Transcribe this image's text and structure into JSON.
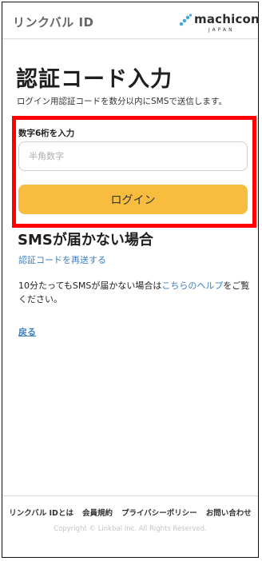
{
  "header": {
    "service_name": "リンクバル ID",
    "logo": {
      "text": "machicon",
      "sub": "JAPAN",
      "icon": "machicon-logo-icon"
    }
  },
  "main": {
    "title": "認証コード入力",
    "description": "ログイン用認証コードを数分以内にSMSで送信します。",
    "form": {
      "label": "数字6桁を入力",
      "input_placeholder": "半角数字",
      "input_value": "",
      "submit_label": "ログイン"
    },
    "sms_section": {
      "title": "SMSが届かない場合",
      "resend_link": "認証コードを再送する",
      "help_prefix": "10分たってもSMSが届かない場合は",
      "help_link": "こちらのヘルプ",
      "help_suffix": "をご覧ください。"
    },
    "back_link": "戻る"
  },
  "footer": {
    "links": [
      "リンクバル IDとは",
      "会員規約",
      "プライバシーポリシー",
      "お問い合わせ"
    ],
    "copyright": "Copyright © Linkbal Inc. All Rights Reserved."
  },
  "colors": {
    "accent_button": "#f8bd3f",
    "link": "#3b7ec0",
    "highlight_border": "#ff0000",
    "logo_icon": "#3aa9dc"
  }
}
